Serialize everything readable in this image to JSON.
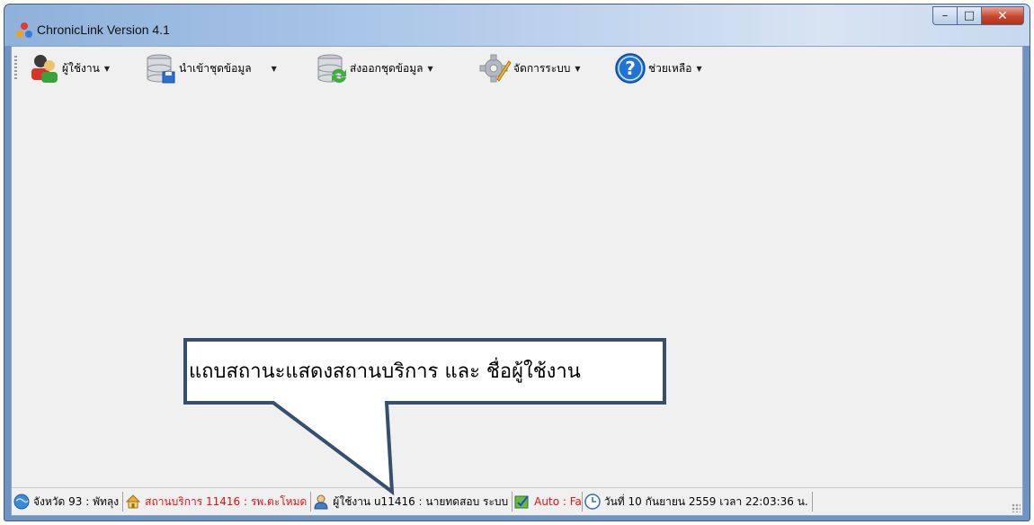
{
  "window": {
    "title": "ChronicLink Version 4.1",
    "controls": {
      "minimize": "–",
      "maximize": "□",
      "close": "✕"
    }
  },
  "toolbar": {
    "items": [
      {
        "label": "ผู้ใช้งาน",
        "icon": "users-icon",
        "has_dropdown": true
      },
      {
        "label": "นำเข้าชุดข้อมูล",
        "icon": "database-import-icon",
        "has_dropdown": true
      },
      {
        "label": "ส่งออกชุดข้อมูล",
        "icon": "database-export-icon",
        "has_dropdown": true
      },
      {
        "label": "จัดการระบบ",
        "icon": "settings-gear-icon",
        "has_dropdown": true
      },
      {
        "label": "ช่วยเหลือ",
        "icon": "help-icon",
        "has_dropdown": true
      }
    ],
    "dropdown_glyph": "▼"
  },
  "callout": {
    "text": "แถบสถานะแสดงสถานบริการ และ ชื่อผู้ใช้งาน"
  },
  "statusbar": {
    "province": "จังหวัด 93 : พัทลุง",
    "service_unit": "สถานบริการ 11416 : รพ.ตะโหมด",
    "user": "ผู้ใช้งาน u11416 : นายทดสอบ  ระบบ",
    "auto": "Auto : Fa",
    "datetime": "วันที่ 10 กันยายน 2559 เวลา 22:03:36 น.",
    "colors": {
      "service_unit": "#e01010",
      "auto": "#e01010"
    }
  }
}
